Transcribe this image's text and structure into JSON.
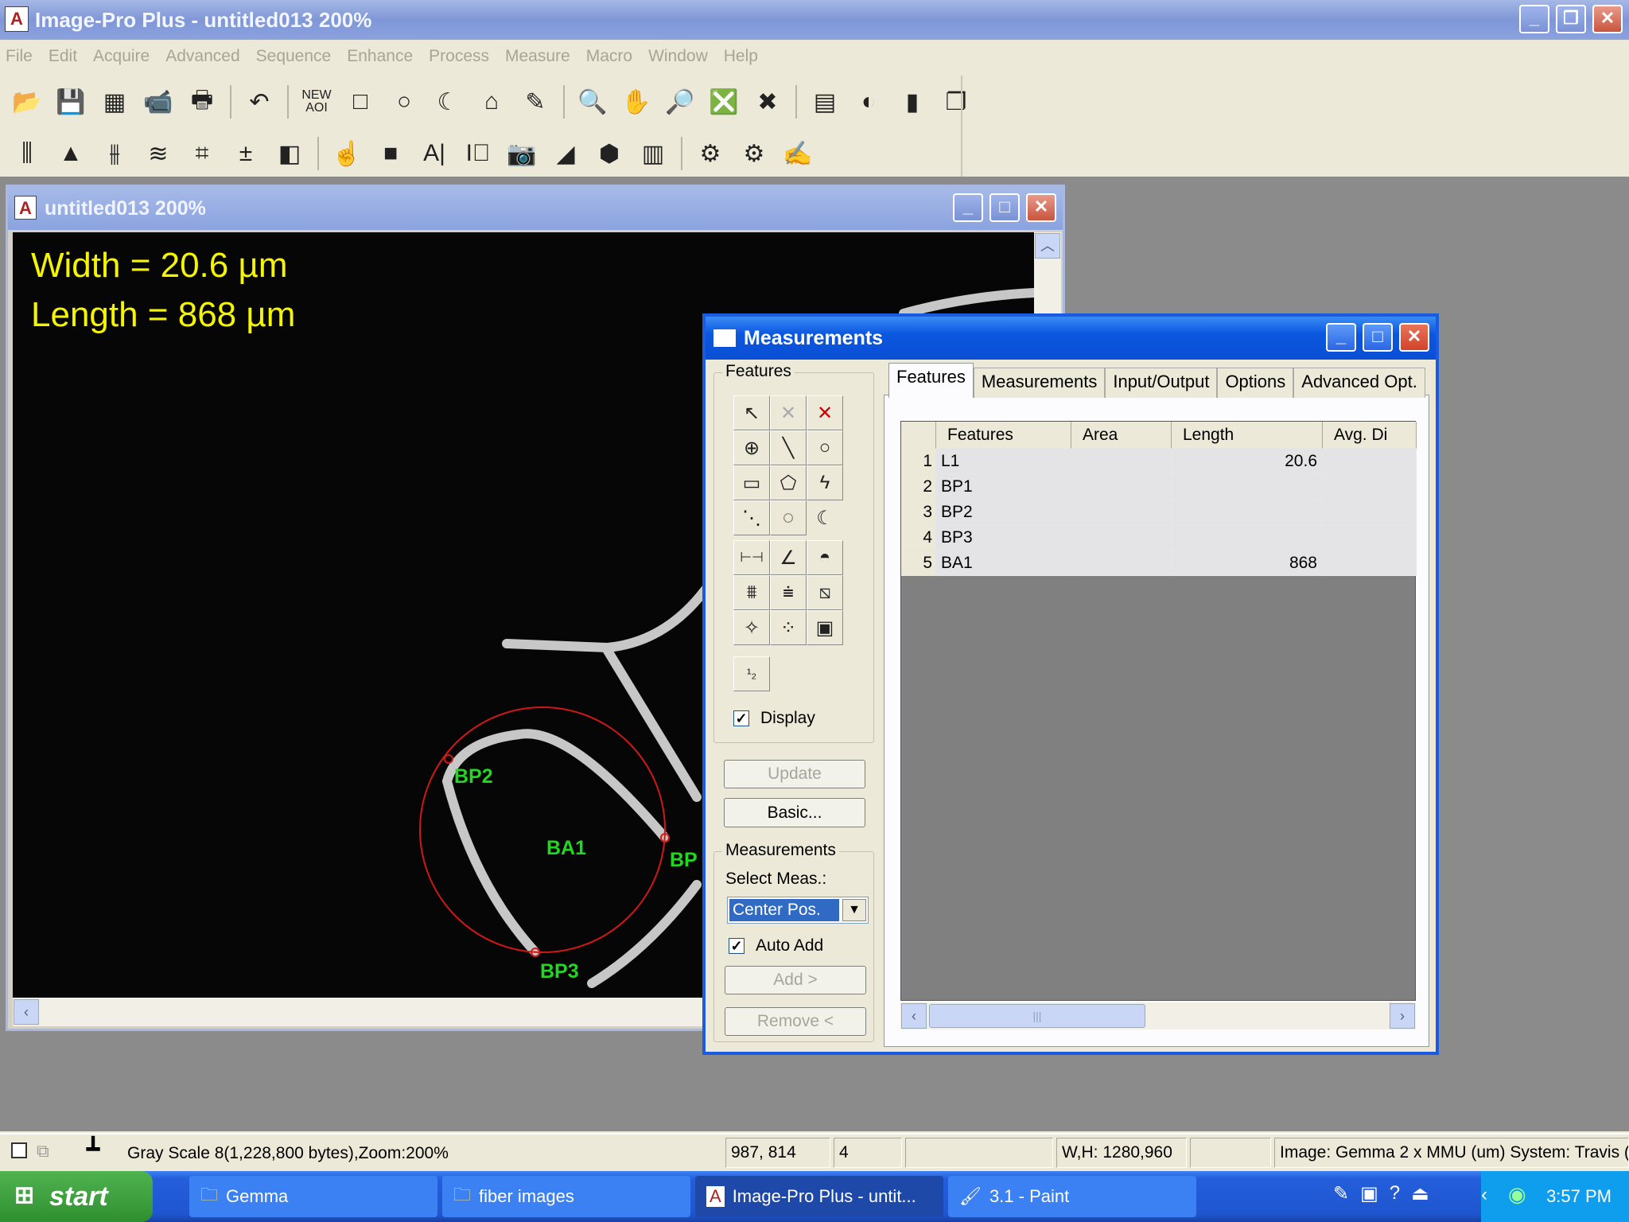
{
  "app": {
    "title": "Image-Pro Plus - untitled013 200%"
  },
  "menu": [
    "File",
    "Edit",
    "Acquire",
    "Advanced",
    "Sequence",
    "Enhance",
    "Process",
    "Measure",
    "Macro",
    "Window",
    "Help"
  ],
  "toolbar1": [
    {
      "icon": "open-icon",
      "g": "📂"
    },
    {
      "icon": "save-icon",
      "g": "💾"
    },
    {
      "icon": "grid-icon",
      "g": "▦"
    },
    {
      "icon": "camera-icon",
      "g": "📹"
    },
    {
      "icon": "print-icon",
      "g": "🖶"
    },
    "|",
    {
      "icon": "undo-icon",
      "g": "↶"
    },
    "|",
    {
      "icon": "new-aoi-icon",
      "g": "NEW\nAOI"
    },
    {
      "icon": "rect-aoi-icon",
      "g": "□"
    },
    {
      "icon": "ellipse-aoi-icon",
      "g": "○"
    },
    {
      "icon": "irregular-aoi-icon",
      "g": "☾"
    },
    {
      "icon": "magic-wand-icon",
      "g": "⌂"
    },
    {
      "icon": "pencil-icon",
      "g": "✎"
    },
    "|",
    {
      "icon": "zoom-icon",
      "g": "🔍"
    },
    {
      "icon": "pan-hand-icon",
      "g": "✋"
    },
    {
      "icon": "zoom-region-icon",
      "g": "🔎"
    },
    {
      "icon": "delete-aoi-icon",
      "g": "❎"
    },
    {
      "icon": "clear-icon",
      "g": "✖"
    },
    "|",
    {
      "icon": "stack-icon",
      "g": "▤"
    },
    {
      "icon": "contrast-icon",
      "g": "◐"
    },
    {
      "icon": "chart-icon",
      "g": "▮"
    },
    {
      "icon": "windows-icon",
      "g": "❐"
    }
  ],
  "toolbar2": [
    {
      "icon": "levels-icon",
      "g": "⫼"
    },
    {
      "icon": "histogram-icon",
      "g": "▲"
    },
    {
      "icon": "sliders-icon",
      "g": "⫵"
    },
    {
      "icon": "layers-icon",
      "g": "≋"
    },
    {
      "icon": "calibrate-grid-icon",
      "g": "⌗"
    },
    {
      "icon": "math-icon",
      "g": "±"
    },
    {
      "icon": "bw-icon",
      "g": "◧"
    },
    "|",
    {
      "icon": "thumbs-icon",
      "g": "☝"
    },
    {
      "icon": "count-icon",
      "g": "■"
    },
    {
      "icon": "measure-text-icon",
      "g": "A|"
    },
    {
      "icon": "line-profile-icon",
      "g": "I⃒"
    },
    {
      "icon": "snapshot-icon",
      "g": "📷"
    },
    {
      "icon": "line-histogram-icon",
      "g": "◢"
    },
    {
      "icon": "3d-cube-icon",
      "g": "⬢"
    },
    {
      "icon": "data-table-icon",
      "g": "▥"
    },
    "|",
    {
      "icon": "macro-icon",
      "g": "⚙"
    },
    {
      "icon": "script-icon",
      "g": "⚙"
    },
    {
      "icon": "edit-note-icon",
      "g": "✍"
    }
  ],
  "image_window": {
    "title": "untitled013 200%"
  },
  "overlay": {
    "width_text": "Width = 20.6 µm",
    "length_text": "Length = 868 µm",
    "labels": {
      "bp2": "BP2",
      "ba1": "BA1",
      "bp3": "BP3",
      "bp1": "BP"
    }
  },
  "colors": {
    "overlay_text": "#f5f500",
    "label_green": "#21d821",
    "circle_red": "#d01818"
  },
  "measurements": {
    "title": "Measurements",
    "features_group": "Features",
    "tools": [
      [
        "pointer-icon",
        "↖"
      ],
      [
        "delete-disabled-icon",
        "✕"
      ],
      [
        "delete-all-icon",
        "✕"
      ],
      [
        "point-icon",
        "⊕"
      ],
      [
        "line-icon",
        "╲"
      ],
      [
        "circle-icon",
        "○"
      ],
      [
        "rectangle-icon",
        "▭"
      ],
      [
        "polygon-icon",
        "⬠"
      ],
      [
        "freehand-icon",
        "ϟ"
      ],
      [
        "dotted-line-icon",
        "⋱"
      ],
      [
        "dotted-circle-icon",
        "◌"
      ],
      [
        "arc-icon",
        "☾"
      ],
      [
        "caliper-icon",
        "⊢⊣"
      ],
      [
        "angle-icon",
        "∠"
      ],
      [
        "protractor-icon",
        "◓"
      ],
      [
        "threshold-icon",
        "⩩"
      ],
      [
        "stack-measure-icon",
        "⩧"
      ],
      [
        "hatch-icon",
        "⧅"
      ],
      [
        "wand-icon",
        "✧"
      ],
      [
        "dots-icon",
        "⁘"
      ],
      [
        "frame-icon",
        "▣"
      ],
      [
        "numbering-icon",
        "¹₂"
      ]
    ],
    "display_label": "Display",
    "update_label": "Update",
    "basic_label": "Basic...",
    "meas_group": "Measurements",
    "select_meas_label": "Select Meas.:",
    "select_value": "Center Pos.",
    "auto_add_label": "Auto Add",
    "add_label": "Add >",
    "remove_label": "Remove <",
    "tabs": [
      "Features",
      "Measurements",
      "Input/Output",
      "Options",
      "Advanced Opt."
    ],
    "columns": [
      "Features",
      "Area",
      "Length",
      "Avg. Di"
    ],
    "rows": [
      {
        "n": "1",
        "feature": "L1",
        "area": "",
        "length": "20.6"
      },
      {
        "n": "2",
        "feature": "BP1",
        "area": "",
        "length": ""
      },
      {
        "n": "3",
        "feature": "BP2",
        "area": "",
        "length": ""
      },
      {
        "n": "4",
        "feature": "BP3",
        "area": "",
        "length": ""
      },
      {
        "n": "5",
        "feature": "BA1",
        "area": "",
        "length": "868"
      }
    ]
  },
  "status": {
    "info": "Gray Scale 8(1,228,800 bytes),Zoom:200%",
    "coords": "987, 814",
    "value": "4",
    "wh": "W,H: 1280,960",
    "image": "Image: Gemma 2 x MMU (um) System: Travis ("
  },
  "taskbar": {
    "start": "start",
    "tasks": [
      "Gemma",
      "fiber images",
      "Image-Pro Plus - untit...",
      "3.1 - Paint"
    ],
    "clock": "3:57 PM"
  }
}
